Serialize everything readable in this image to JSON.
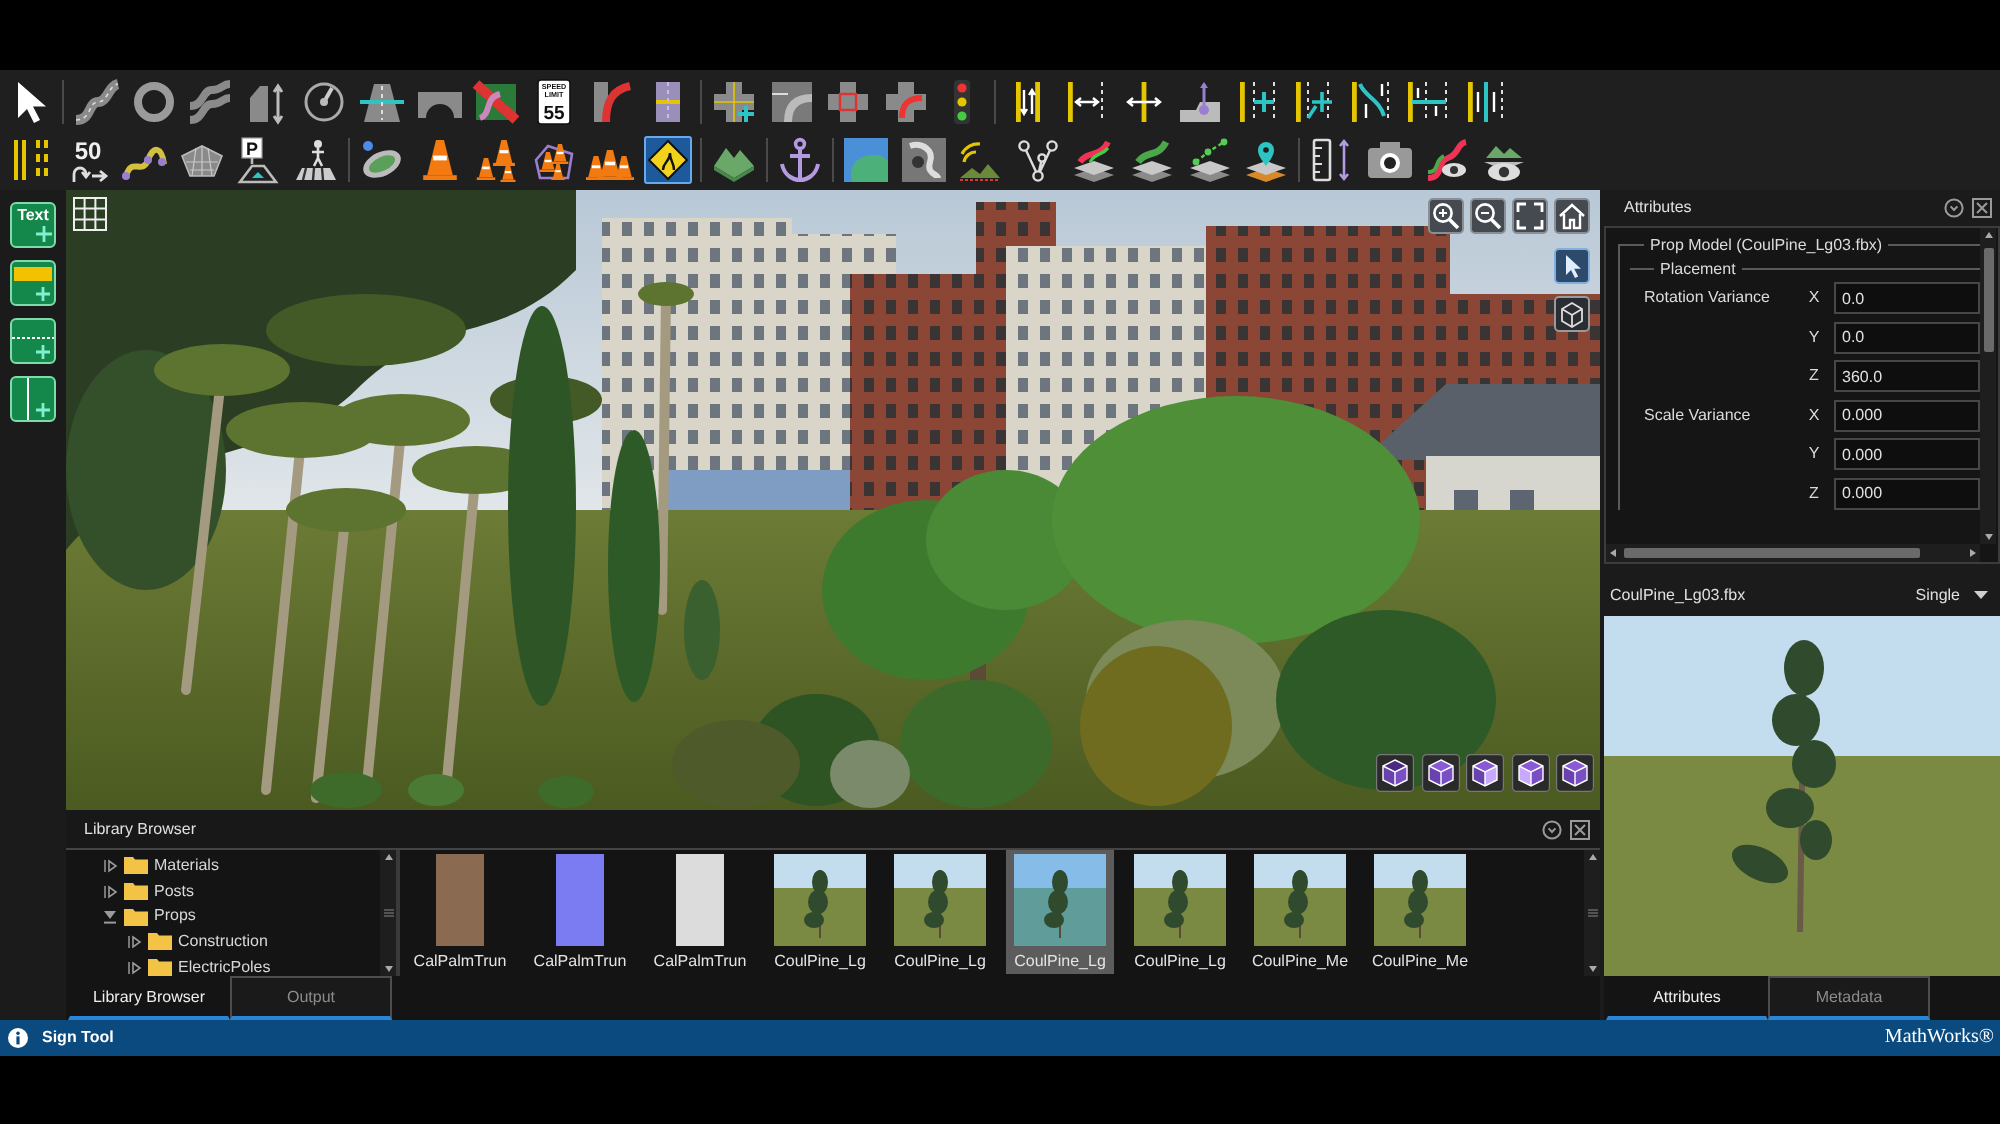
{
  "toolbar": {
    "rows": [
      {
        "groups": [
          [
            {
              "selected": false
            }
          ],
          [
            {
              "selected": false
            },
            {
              "selected": false
            },
            {
              "selected": false
            },
            {
              "selected": false
            },
            {
              "selected": false
            },
            {
              "selected": false
            },
            {
              "selected": false
            },
            {
              "selected": false
            },
            {
              "selected": false,
              "caption_lines": [
                "SPEED",
                "LIMIT"
              ],
              "label": "55"
            },
            {
              "selected": false
            },
            {
              "selected": false
            }
          ],
          [
            {
              "selected": false
            },
            {
              "selected": false
            },
            {
              "selected": false
            },
            {
              "selected": false
            },
            {
              "selected": false
            }
          ],
          [
            {
              "selected": false
            },
            {
              "selected": false
            },
            {
              "selected": false
            },
            {
              "selected": false
            },
            {
              "selected": false
            },
            {
              "selected": false
            },
            {
              "selected": false
            },
            {
              "selected": false
            },
            {
              "selected": false
            }
          ]
        ]
      },
      {
        "groups": [
          [
            {
              "selected": false
            },
            {
              "selected": false,
              "label": "50"
            },
            {
              "selected": false
            },
            {
              "selected": false
            },
            {
              "selected": false,
              "label": "P"
            },
            {
              "selected": false
            }
          ],
          [
            {
              "selected": false
            },
            {
              "selected": false
            },
            {
              "selected": false
            },
            {
              "selected": false
            },
            {
              "selected": false
            },
            {
              "selected": true
            }
          ],
          [
            {
              "selected": false
            }
          ],
          [
            {
              "selected": false
            }
          ],
          [
            {
              "selected": false
            },
            {
              "selected": false
            },
            {
              "selected": false
            },
            {
              "selected": false
            },
            {
              "selected": false
            },
            {
              "selected": false
            },
            {
              "selected": false
            },
            {
              "selected": false
            }
          ],
          [
            {
              "selected": false
            },
            {
              "selected": false
            },
            {
              "selected": false
            },
            {
              "selected": false
            }
          ]
        ]
      }
    ]
  },
  "side_tools": [
    {
      "kind": "text",
      "label": "Text"
    },
    {
      "kind": "fill"
    },
    {
      "kind": "dashed"
    },
    {
      "kind": "split"
    }
  ],
  "library_browser": {
    "title": "Library Browser",
    "tree": [
      {
        "label": "Materials",
        "expanded": false
      },
      {
        "label": "Posts",
        "expanded": false
      },
      {
        "label": "Props",
        "expanded": true,
        "children": [
          {
            "label": "Construction",
            "expanded": false
          },
          {
            "label": "ElectricPoles",
            "expanded": false
          }
        ]
      }
    ],
    "assets": [
      {
        "kind": "texture",
        "name": "CalPalmTrun",
        "color": "#8a6a50",
        "selected": false
      },
      {
        "kind": "texture",
        "name": "CalPalmTrun",
        "color": "#7b7cf2",
        "selected": false
      },
      {
        "kind": "texture",
        "name": "CalPalmTrun",
        "color": "#dcdcdc",
        "selected": false
      },
      {
        "kind": "model",
        "name": "CoulPine_Lg",
        "selected": false
      },
      {
        "kind": "model",
        "name": "CoulPine_Lg",
        "selected": false
      },
      {
        "kind": "model",
        "name": "CoulPine_Lg",
        "selected": true
      },
      {
        "kind": "model",
        "name": "CoulPine_Lg",
        "selected": false
      },
      {
        "kind": "model",
        "name": "CoulPine_Me",
        "selected": false
      },
      {
        "kind": "model",
        "name": "CoulPine_Me",
        "selected": false
      }
    ],
    "tabs": [
      {
        "label": "Library Browser",
        "selected": true
      },
      {
        "label": "Output",
        "selected": false
      }
    ]
  },
  "inspector": {
    "title": "Attributes",
    "model_group": {
      "legend": "Prop Model (CoulPine_Lg03.fbx)",
      "section": {
        "legend": "Placement",
        "properties": [
          {
            "label": "Rotation Variance",
            "fields": [
              {
                "axis": "X",
                "value": "0.0"
              },
              {
                "axis": "Y",
                "value": "0.0"
              },
              {
                "axis": "Z",
                "value": "360.0"
              }
            ]
          },
          {
            "label": "Scale Variance",
            "fields": [
              {
                "axis": "X",
                "value": "0.000"
              },
              {
                "axis": "Y",
                "value": "0.000"
              },
              {
                "axis": "Z",
                "value": "0.000"
              }
            ]
          }
        ]
      }
    },
    "preview": {
      "file_name": "CoulPine_Lg03.fbx",
      "mode": "Single"
    },
    "tabs": [
      {
        "label": "Attributes",
        "selected": true
      },
      {
        "label": "Metadata",
        "selected": false
      }
    ]
  },
  "status_bar": {
    "message": "Sign Tool",
    "brand": "MathWorks®"
  }
}
